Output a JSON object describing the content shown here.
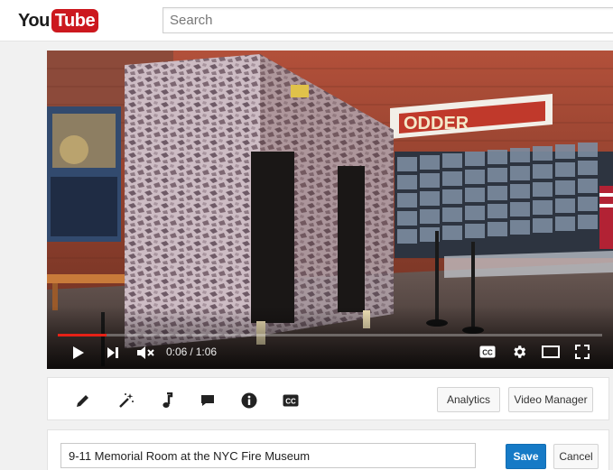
{
  "header": {
    "logo_you": "You",
    "logo_tube": "Tube",
    "search_placeholder": "Search"
  },
  "player": {
    "current_time": "0:06",
    "separator": "/",
    "duration": "1:06",
    "progress_fraction": 0.09,
    "scene_sign_text": "ODDER"
  },
  "toolbar": {
    "tools": [
      "pencil-icon",
      "magic-wand-icon",
      "music-note-icon",
      "comment-icon",
      "info-icon",
      "cc-icon"
    ],
    "cc_label": "CC",
    "analytics_label": "Analytics",
    "video_manager_label": "Video Manager"
  },
  "title_form": {
    "title_value": "9-11 Memorial Room at the NYC Fire Museum",
    "save_label": "Save",
    "cancel_label": "Cancel"
  },
  "colors": {
    "brand_red": "#cc181e",
    "progress_red": "#e62117",
    "save_blue": "#167ac6"
  }
}
